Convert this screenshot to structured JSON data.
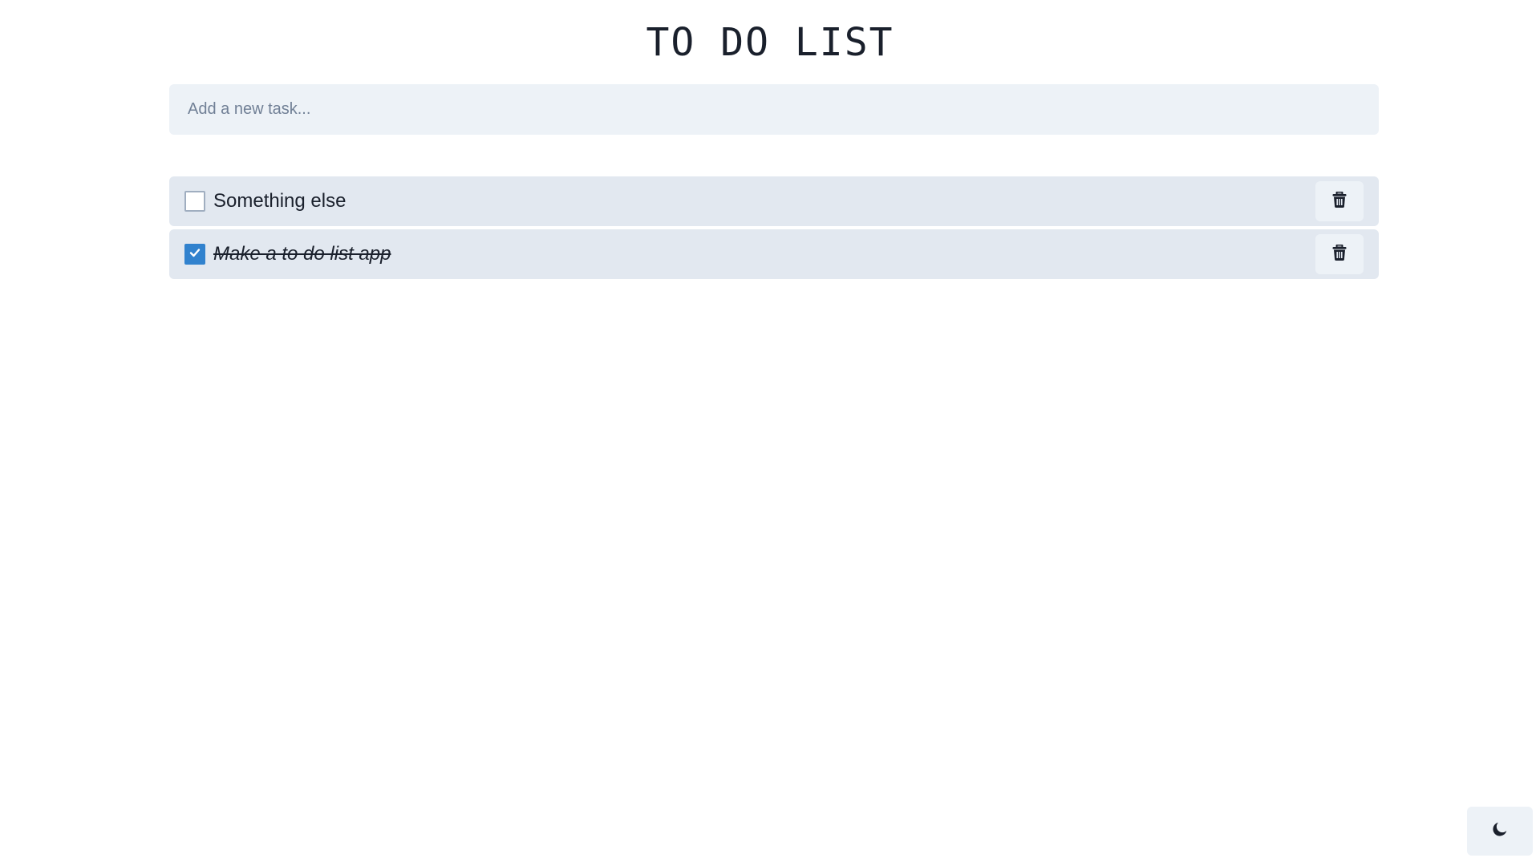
{
  "header": {
    "title": "TO DO LIST"
  },
  "new_task": {
    "placeholder": "Add a new task...",
    "value": ""
  },
  "tasks": [
    {
      "text": "Something else",
      "completed": false,
      "delete_icon": "trash-icon"
    },
    {
      "text": "Make a to do list app",
      "completed": true,
      "delete_icon": "trash-icon"
    }
  ],
  "theme_toggle": {
    "icon": "moon-icon"
  },
  "colors": {
    "accent": "#3182ce",
    "row_background": "#e2e8f0",
    "input_background": "#edf2f7",
    "text": "#1a202c",
    "placeholder": "#718096"
  }
}
